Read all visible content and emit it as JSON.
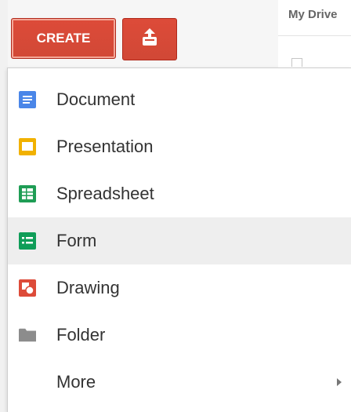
{
  "header": {
    "drive_title": "My Drive"
  },
  "buttons": {
    "create_label": "CREATE"
  },
  "menu": {
    "items": [
      {
        "label": "Document",
        "icon": "document-icon",
        "color": "#4a86e8"
      },
      {
        "label": "Presentation",
        "icon": "presentation-icon",
        "color": "#f1b100"
      },
      {
        "label": "Spreadsheet",
        "icon": "spreadsheet-icon",
        "color": "#1f9d55"
      },
      {
        "label": "Form",
        "icon": "form-icon",
        "color": "#0f9d58"
      },
      {
        "label": "Drawing",
        "icon": "drawing-icon",
        "color": "#dd4b39"
      },
      {
        "label": "Folder",
        "icon": "folder-icon",
        "color": "#8c8c8c"
      },
      {
        "label": "More",
        "icon": "chevron-right-icon",
        "color": "#777777"
      }
    ]
  },
  "colors": {
    "create_red": "#d14836",
    "highlight": "#eeeeee"
  }
}
